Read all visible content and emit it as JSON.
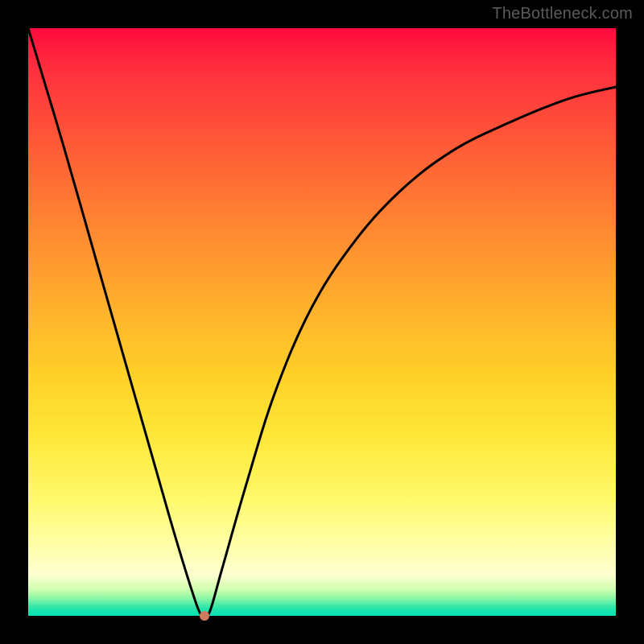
{
  "watermark": "TheBottleneck.com",
  "chart_data": {
    "type": "line",
    "title": "",
    "xlabel": "",
    "ylabel": "",
    "xlim": [
      0,
      100
    ],
    "ylim": [
      0,
      100
    ],
    "grid": false,
    "legend": null,
    "series": [
      {
        "name": "bottleneck-curve",
        "x": [
          0,
          6,
          12,
          18,
          24,
          27,
          29,
          30,
          31,
          33,
          37,
          42,
          48,
          55,
          63,
          72,
          82,
          92,
          100
        ],
        "y": [
          100,
          80,
          59,
          38,
          17,
          7,
          1,
          0,
          1,
          8,
          22,
          38,
          52,
          63,
          72,
          79,
          84,
          88,
          90
        ]
      }
    ],
    "marker": {
      "x": 30,
      "y": 0,
      "name": "optimal-point"
    },
    "background_gradient": {
      "stops": [
        {
          "pos": 0.0,
          "color": "#ff0a3e"
        },
        {
          "pos": 0.5,
          "color": "#ffc028"
        },
        {
          "pos": 0.85,
          "color": "#ffff90"
        },
        {
          "pos": 1.0,
          "color": "#00e0b3"
        }
      ]
    }
  }
}
